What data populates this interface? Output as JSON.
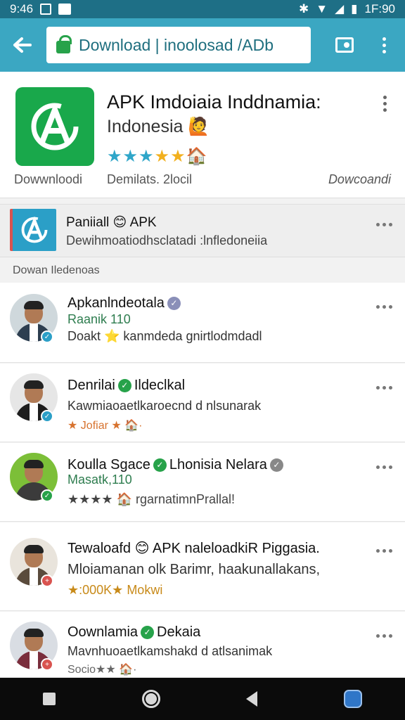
{
  "status_bar": {
    "time": "9:46",
    "right_text": "1F:90"
  },
  "toolbar": {
    "url": "Download | inoolosad /ADb"
  },
  "app": {
    "title": "APK Imdoiaia Inddnamia:",
    "subtitle": "Indonesia 🙋",
    "stars": "★★★★★",
    "download_label": "Dowwnloodi",
    "details_label": "Demilats. 2locil",
    "right_label": "Dowcoandi",
    "colors": {
      "icon_bg": "#19a84b",
      "star": "#f2b01e"
    }
  },
  "featured": {
    "title": "Paniiall 😊 APK",
    "subtitle": "Dewihmoatiodhsclatadi :lnfledoneiia"
  },
  "section_label": "Dowan Iledenoas",
  "list": [
    {
      "name": "Apkanlndeotala",
      "badge_color": "#8a8fb8",
      "meta": "Raanik 110",
      "line": "Doakt ⭐ kanmdeda gnirtlodmdadl",
      "status_badge_color": "#2b9fc7"
    },
    {
      "name": "Denrilai",
      "badge_color": "#27a24a",
      "extra": "Ildeclkal",
      "line": "Kawmiaoaetlkaroecnd d nlsunarak",
      "stars_line": "★ Jofiar ★ 🏠·",
      "status_badge_color": "#2b9fc7"
    },
    {
      "name": "Koulla Sgace",
      "badge_color": "#27a24a",
      "extra": "Lhonisia Nelara",
      "meta": "Masatk,110",
      "stars_line": "★★★★ 🏠 rgarnatimnPrallal!",
      "status_badge_color": "#27a24a"
    },
    {
      "name": "Tewaloafd 😊 APK naleloadkiR Piggasia.",
      "line": "Mloiamanan olk Barimr, haakunallakans,",
      "stars_line": "★:000K★ Mokwi",
      "status_badge_color": "#d9534f"
    },
    {
      "name": "Oownlamia",
      "badge_color": "#27a24a",
      "extra": "Dekaia",
      "line": "Mavnhuoaetlkamshakd d atlsanimak",
      "stars_line": "Socio★★ 🏠·",
      "status_badge_color": "#d9534f"
    }
  ]
}
